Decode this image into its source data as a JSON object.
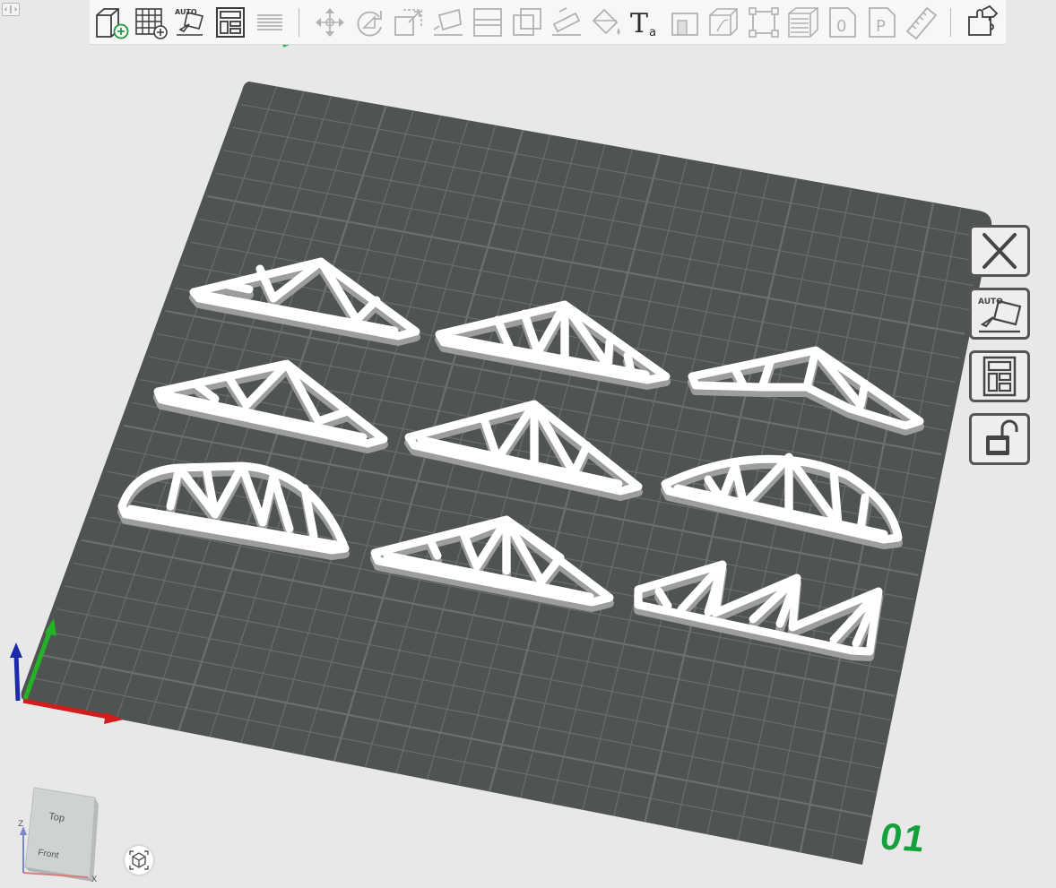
{
  "panel_toggle_label": "‹|›",
  "toolbar": {
    "tools": [
      {
        "name": "add-model-icon",
        "state": "enabled"
      },
      {
        "name": "add-grid-icon",
        "state": "enabled"
      },
      {
        "name": "auto-arrange-icon",
        "state": "enabled",
        "label": "AUTO"
      },
      {
        "name": "layout-icon",
        "state": "enabled"
      },
      {
        "name": "layer-list-icon",
        "state": "disabled"
      },
      {
        "name": "move-icon",
        "state": "disabled"
      },
      {
        "name": "rotate-icon",
        "state": "disabled"
      },
      {
        "name": "scale-icon",
        "state": "disabled"
      },
      {
        "name": "lay-flat-icon",
        "state": "disabled"
      },
      {
        "name": "split-icon",
        "state": "disabled"
      },
      {
        "name": "hollow-icon",
        "state": "disabled"
      },
      {
        "name": "cut-icon",
        "state": "disabled"
      },
      {
        "name": "paint-icon",
        "state": "disabled"
      },
      {
        "name": "text-icon",
        "state": "enabled",
        "label": "T",
        "sublabel": "a"
      },
      {
        "name": "emboss-icon",
        "state": "disabled"
      },
      {
        "name": "boolean-icon",
        "state": "disabled"
      },
      {
        "name": "support-icon",
        "state": "disabled"
      },
      {
        "name": "variable-layer-icon",
        "state": "disabled"
      },
      {
        "name": "seam-icon",
        "state": "disabled",
        "label": "0"
      },
      {
        "name": "placeholder-icon",
        "state": "disabled",
        "label": "P"
      },
      {
        "name": "measure-icon",
        "state": "disabled"
      },
      {
        "name": "assembly-icon",
        "state": "enabled"
      }
    ]
  },
  "side_tools": [
    {
      "name": "remove-plate-icon"
    },
    {
      "name": "arrange-plate-icon",
      "label": "AUTO"
    },
    {
      "name": "plate-settings-icon"
    },
    {
      "name": "lock-plate-icon"
    }
  ],
  "plate": {
    "number": "01",
    "label_marker": "≤"
  },
  "view_cube": {
    "top_label": "Top",
    "front_label": "Front",
    "axis_z": "Z",
    "axis_x": "X"
  },
  "recenter_icon": "recenter-icon",
  "colors": {
    "plate": "#4f5453",
    "grid_line": "#6a706f",
    "model": "#ffffff",
    "model_shadow": "#9d9d9d",
    "axis_x": "#d21d1d",
    "axis_y": "#23b325",
    "axis_z": "#1a2aa8",
    "plate_number": "#14a03a",
    "icon": "#4a4a4a"
  },
  "models": [
    {
      "name": "truss-fink-1",
      "type": "fink"
    },
    {
      "name": "truss-howe-1",
      "type": "howe"
    },
    {
      "name": "truss-scissor",
      "type": "scissor"
    },
    {
      "name": "truss-fink-2",
      "type": "fink"
    },
    {
      "name": "truss-king",
      "type": "king"
    },
    {
      "name": "truss-bowstring",
      "type": "bowstring"
    },
    {
      "name": "truss-arched",
      "type": "arched"
    },
    {
      "name": "truss-fan",
      "type": "fan"
    },
    {
      "name": "truss-sawtooth",
      "type": "sawtooth"
    }
  ]
}
